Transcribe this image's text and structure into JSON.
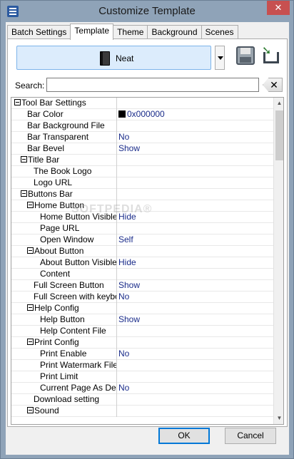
{
  "window": {
    "title": "Customize Template",
    "close_glyph": "✕"
  },
  "tabs": [
    {
      "label": "Batch Settings",
      "active": false
    },
    {
      "label": "Template",
      "active": true
    },
    {
      "label": "Theme",
      "active": false
    },
    {
      "label": "Background",
      "active": false
    },
    {
      "label": "Scenes",
      "active": false
    }
  ],
  "template_selector": {
    "label": "Neat",
    "icon": "book-icon"
  },
  "toolbar": {
    "save_icon": "save-icon",
    "export_icon": "export-icon"
  },
  "search": {
    "label": "Search:",
    "value": "",
    "placeholder": "",
    "clear_glyph": "✕"
  },
  "watermark": "SOFTPEDIA®",
  "tree": [
    {
      "indent": 0,
      "toggle": true,
      "name": "Tool Bar Settings",
      "value": ""
    },
    {
      "indent": 2,
      "toggle": false,
      "name": "Bar Color",
      "value": "0x000000",
      "swatch": "#000000"
    },
    {
      "indent": 2,
      "toggle": false,
      "name": "Bar Background File",
      "value": ""
    },
    {
      "indent": 2,
      "toggle": false,
      "name": "Bar Transparent",
      "value": "No"
    },
    {
      "indent": 2,
      "toggle": false,
      "name": "Bar Bevel",
      "value": "Show"
    },
    {
      "indent": 1,
      "toggle": true,
      "name": "Title Bar",
      "value": ""
    },
    {
      "indent": 3,
      "toggle": false,
      "name": "The Book Logo",
      "value": ""
    },
    {
      "indent": 3,
      "toggle": false,
      "name": "Logo URL",
      "value": ""
    },
    {
      "indent": 1,
      "toggle": true,
      "name": "Buttons Bar",
      "value": ""
    },
    {
      "indent": 2,
      "toggle": true,
      "name": "Home Button",
      "value": ""
    },
    {
      "indent": 4,
      "toggle": false,
      "name": "Home Button Visible",
      "value": "Hide"
    },
    {
      "indent": 4,
      "toggle": false,
      "name": "Page URL",
      "value": ""
    },
    {
      "indent": 4,
      "toggle": false,
      "name": "Open Window",
      "value": "Self"
    },
    {
      "indent": 2,
      "toggle": true,
      "name": "About Button",
      "value": ""
    },
    {
      "indent": 4,
      "toggle": false,
      "name": "About Button Visible",
      "value": "Hide"
    },
    {
      "indent": 4,
      "toggle": false,
      "name": "Content",
      "value": ""
    },
    {
      "indent": 3,
      "toggle": false,
      "name": "Full Screen Button",
      "value": "Show"
    },
    {
      "indent": 3,
      "toggle": false,
      "name": "Full Screen with keybo...",
      "value": "No"
    },
    {
      "indent": 2,
      "toggle": true,
      "name": "Help Config",
      "value": ""
    },
    {
      "indent": 4,
      "toggle": false,
      "name": "Help Button",
      "value": "Show"
    },
    {
      "indent": 4,
      "toggle": false,
      "name": "Help Content File",
      "value": ""
    },
    {
      "indent": 2,
      "toggle": true,
      "name": "Print Config",
      "value": ""
    },
    {
      "indent": 4,
      "toggle": false,
      "name": "Print Enable",
      "value": "No"
    },
    {
      "indent": 4,
      "toggle": false,
      "name": "Print Watermark File",
      "value": ""
    },
    {
      "indent": 4,
      "toggle": false,
      "name": "Print Limit",
      "value": ""
    },
    {
      "indent": 4,
      "toggle": false,
      "name": "Current Page As De...",
      "value": "No"
    },
    {
      "indent": 3,
      "toggle": false,
      "name": "Download setting",
      "value": ""
    },
    {
      "indent": 2,
      "toggle": true,
      "name": "Sound",
      "value": ""
    }
  ],
  "scrollbar": {
    "position": 0.0
  },
  "buttons": {
    "ok": "OK",
    "cancel": "Cancel"
  }
}
